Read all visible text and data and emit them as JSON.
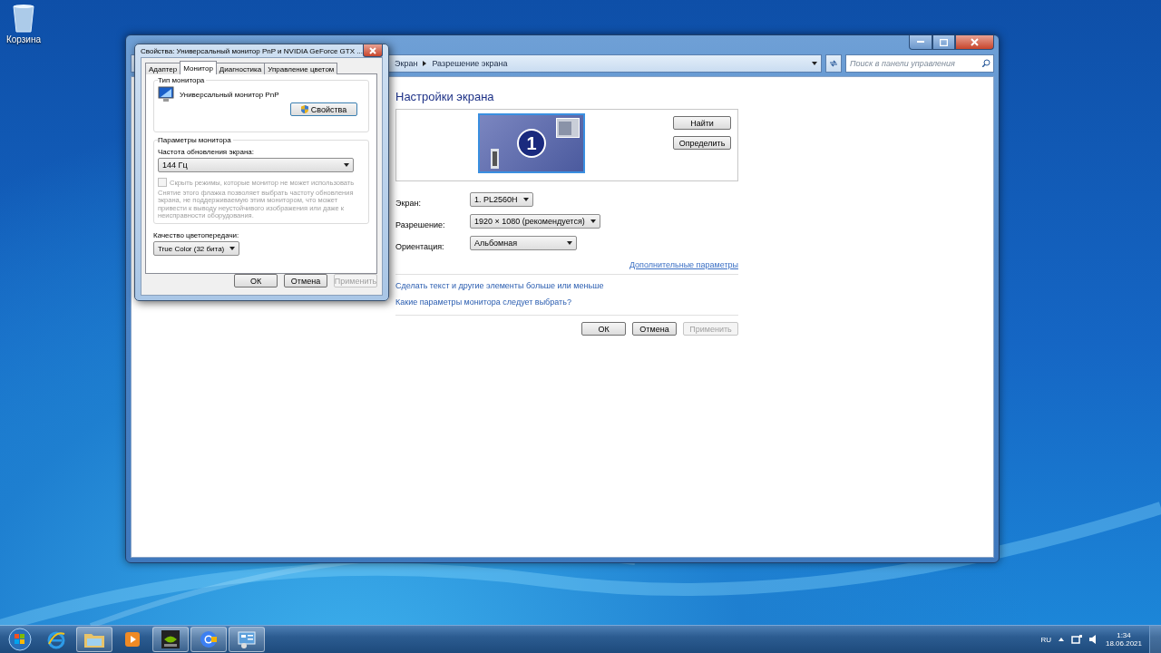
{
  "desktop": {
    "icons": [
      {
        "label": "Корзина"
      }
    ]
  },
  "control_panel": {
    "breadcrumb": [
      "Экран",
      "Разрешение экрана"
    ],
    "search": {
      "placeholder": "Поиск в панели управления"
    },
    "heading": "Настройки экрана",
    "display_number": "1",
    "side_buttons": [
      {
        "label": "Найти",
        "disabled": false
      },
      {
        "label": "Определить",
        "disabled": false
      }
    ],
    "fields": [
      {
        "label": "Экран:",
        "value": "1. PL2560H"
      },
      {
        "label": "Разрешение:",
        "value": "1920 × 1080 (рекомендуется)"
      },
      {
        "label": "Ориентация:",
        "value": "Альбомная"
      }
    ],
    "advanced_link": "Дополнительные параметры",
    "links": [
      "Сделать текст и другие элементы больше или меньше",
      "Какие параметры монитора следует выбрать?"
    ],
    "buttons": [
      {
        "label": "ОК",
        "disabled": false
      },
      {
        "label": "Отмена",
        "disabled": false
      },
      {
        "label": "Применить",
        "disabled": true
      }
    ]
  },
  "dialog": {
    "title": "Свойства: Универсальный монитор PnP и NVIDIA GeForce GTX ...",
    "tabs": [
      {
        "label": "Адаптер",
        "selected": false
      },
      {
        "label": "Монитор",
        "selected": true
      },
      {
        "label": "Диагностика",
        "selected": false
      },
      {
        "label": "Управление цветом",
        "selected": false
      }
    ],
    "monitor_type": {
      "group": "Тип монитора",
      "name": "Универсальный монитор PnP",
      "button": "Свойства"
    },
    "monitor_settings": {
      "group": "Параметры монитора",
      "refresh_label": "Частота обновления экрана:",
      "refresh_value": "144 Гц",
      "checkbox": {
        "label": "Скрыть режимы, которые монитор не может использовать",
        "checked": false,
        "disabled": true
      },
      "note": "Снятие этого флажка позволяет выбрать частоту обновления экрана, не поддерживаемую этим монитором, что может привести к выводу неустойчивого изображения или даже к неисправности оборудования."
    },
    "color_label": "Качество цветопередачи:",
    "color_value": "True Color (32 бита)",
    "buttons": [
      {
        "label": "ОК",
        "disabled": false
      },
      {
        "label": "Отмена",
        "disabled": false
      },
      {
        "label": "Применить",
        "disabled": true
      }
    ]
  },
  "taskbar": {
    "apps": [
      {
        "kind": "browser-e"
      },
      {
        "kind": "folder"
      },
      {
        "kind": "media"
      },
      {
        "kind": "gpu"
      },
      {
        "kind": "chrome"
      },
      {
        "kind": "control"
      }
    ],
    "language": "RU",
    "time": "1:34",
    "date": "18.06.2021"
  }
}
